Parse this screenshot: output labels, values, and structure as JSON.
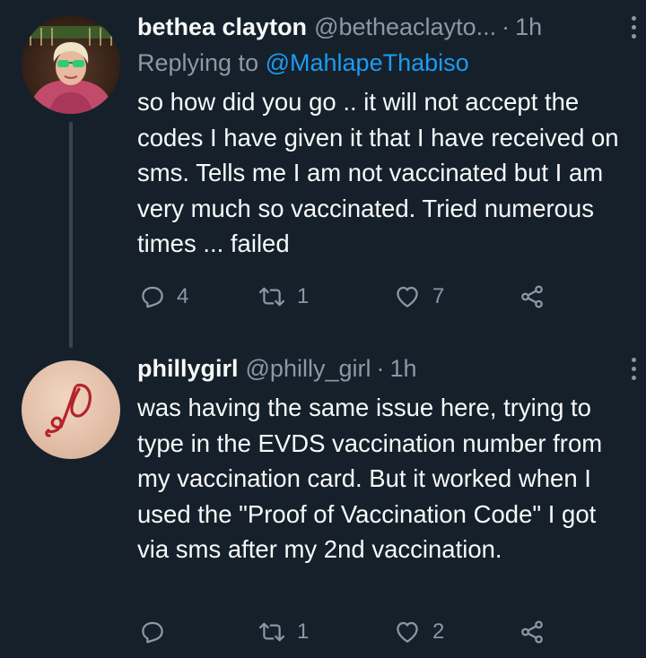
{
  "tweets": [
    {
      "author_name": "bethea clayton",
      "author_handle": "@betheaclayto...",
      "separator": "·",
      "time": "1h",
      "replying_prefix": "Replying to",
      "replying_to": "@MahlapeThabiso",
      "text": "so how did you go .. it will not accept the codes I have given it that I have received on sms. Tells me I am not vaccinated but I am very much so vaccinated. Tried numerous times ... failed",
      "reply_count": "4",
      "retweet_count": "1",
      "like_count": "7",
      "icons": {
        "reply": "reply-icon",
        "retweet": "retweet-icon",
        "like": "heart-icon",
        "share": "share-icon",
        "more": "more-vertical-icon"
      }
    },
    {
      "author_name": "phillygirl",
      "author_handle": "@philly_girl",
      "separator": "·",
      "time": "1h",
      "text": "was having the same issue here, trying to type in the EVDS vaccination number from my vaccination card. But it worked when I used the \"Proof of Vaccination Code\" I got via sms after my 2nd vaccination.",
      "reply_count": "",
      "retweet_count": "1",
      "like_count": "2",
      "icons": {
        "reply": "reply-icon",
        "retweet": "retweet-icon",
        "like": "heart-icon",
        "share": "share-icon",
        "more": "more-vertical-icon"
      }
    }
  ],
  "colors": {
    "background": "#15202b",
    "primary_text": "#f7f9f9",
    "secondary_text": "#8b98a5",
    "link": "#1d9bf0",
    "thread_line": "#38444d"
  }
}
